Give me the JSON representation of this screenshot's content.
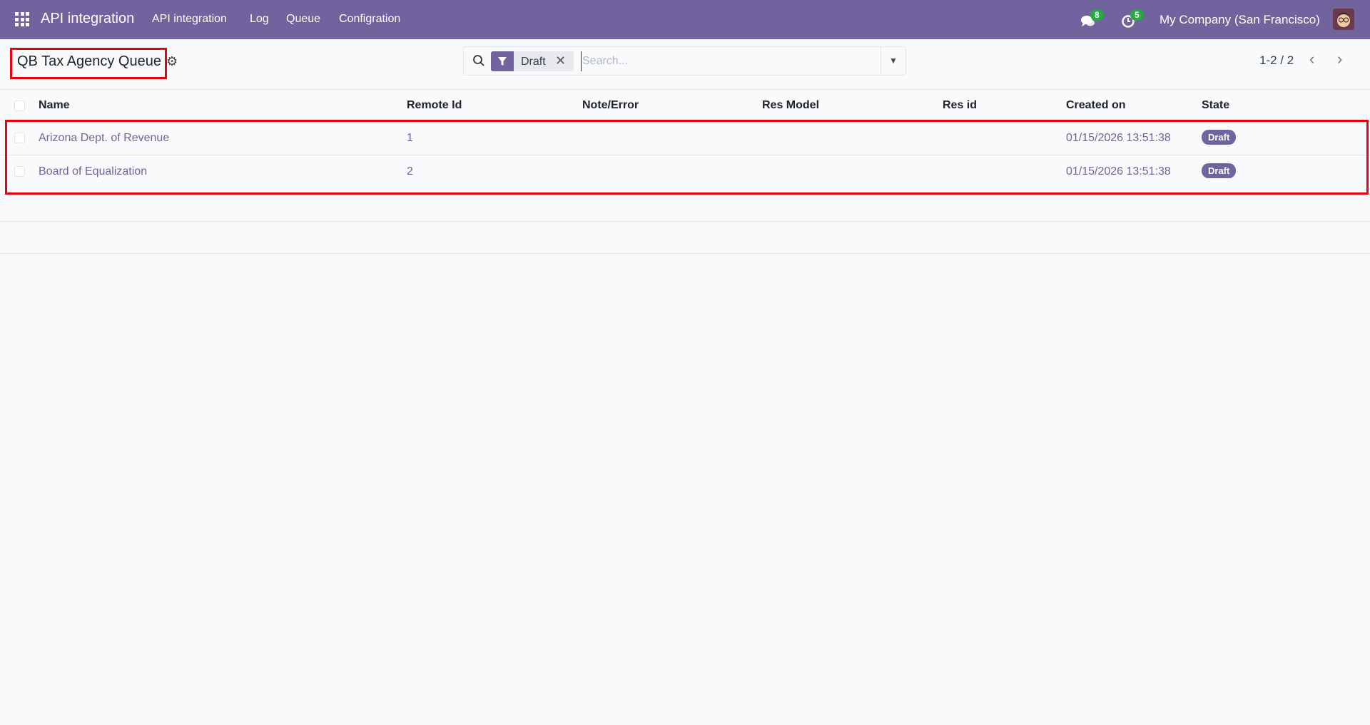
{
  "navbar": {
    "app_title": "API integration",
    "menu": [
      "API integration",
      "Log",
      "Queue",
      "Configration"
    ],
    "messages_count": "8",
    "activities_count": "5",
    "company": "My Company (San Francisco)"
  },
  "control": {
    "title": "QB Tax Agency Queue",
    "facet": "Draft",
    "search_placeholder": "Search...",
    "pager": "1-2 / 2"
  },
  "table": {
    "columns": [
      "Name",
      "Remote Id",
      "Note/Error",
      "Res Model",
      "Res id",
      "Created on",
      "State"
    ],
    "rows": [
      {
        "name": "Arizona Dept. of Revenue",
        "remote_id": "1",
        "note": "",
        "res_model": "",
        "res_id": "",
        "created_on": "01/15/2026 13:51:38",
        "state": "Draft"
      },
      {
        "name": "Board of Equalization",
        "remote_id": "2",
        "note": "",
        "res_model": "",
        "res_id": "",
        "created_on": "01/15/2026 13:51:38",
        "state": "Draft"
      }
    ]
  },
  "colors": {
    "brand": "#71639e",
    "badge": "#28a745",
    "highlight": "#e8000b"
  }
}
